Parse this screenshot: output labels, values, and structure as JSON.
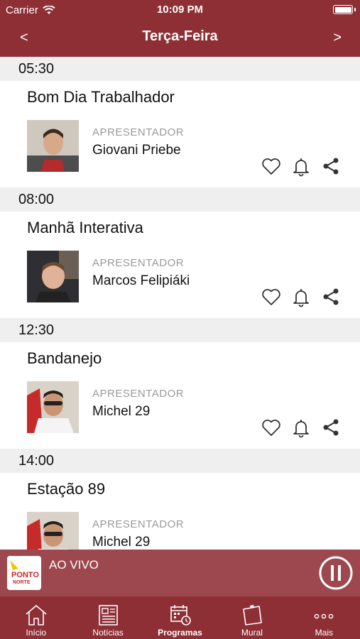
{
  "status_bar": {
    "carrier": "Carrier",
    "time": "10:09 PM"
  },
  "nav": {
    "prev_label": "<",
    "title": "Terça-Feira",
    "next_label": ">"
  },
  "schedule": [
    {
      "time": "05:30",
      "program": "Bom Dia Trabalhador",
      "role": "APRESENTADOR",
      "host": "Giovani Priebe"
    },
    {
      "time": "08:00",
      "program": "Manhã Interativa",
      "role": "APRESENTADOR",
      "host": "Marcos Felipiáki"
    },
    {
      "time": "12:30",
      "program": "Bandanejo",
      "role": "APRESENTADOR",
      "host": "Michel 29"
    },
    {
      "time": "14:00",
      "program": "Estação 89",
      "role": "APRESENTADOR",
      "host": "Michel 29"
    }
  ],
  "player": {
    "label": "AO VIVO",
    "logo_text_1": "PONTO",
    "logo_text_2": "NORTE"
  },
  "tabs": [
    {
      "label": "Início",
      "icon": "home-icon"
    },
    {
      "label": "Notícias",
      "icon": "newspaper-icon"
    },
    {
      "label": "Programas",
      "icon": "calendar-clock-icon"
    },
    {
      "label": "Mural",
      "icon": "note-board-icon"
    },
    {
      "label": "Mais",
      "icon": "more-dots-icon"
    }
  ],
  "colors": {
    "brand": "#8e2f36",
    "section_bg": "#efefef",
    "muted": "#9a9a9a"
  }
}
